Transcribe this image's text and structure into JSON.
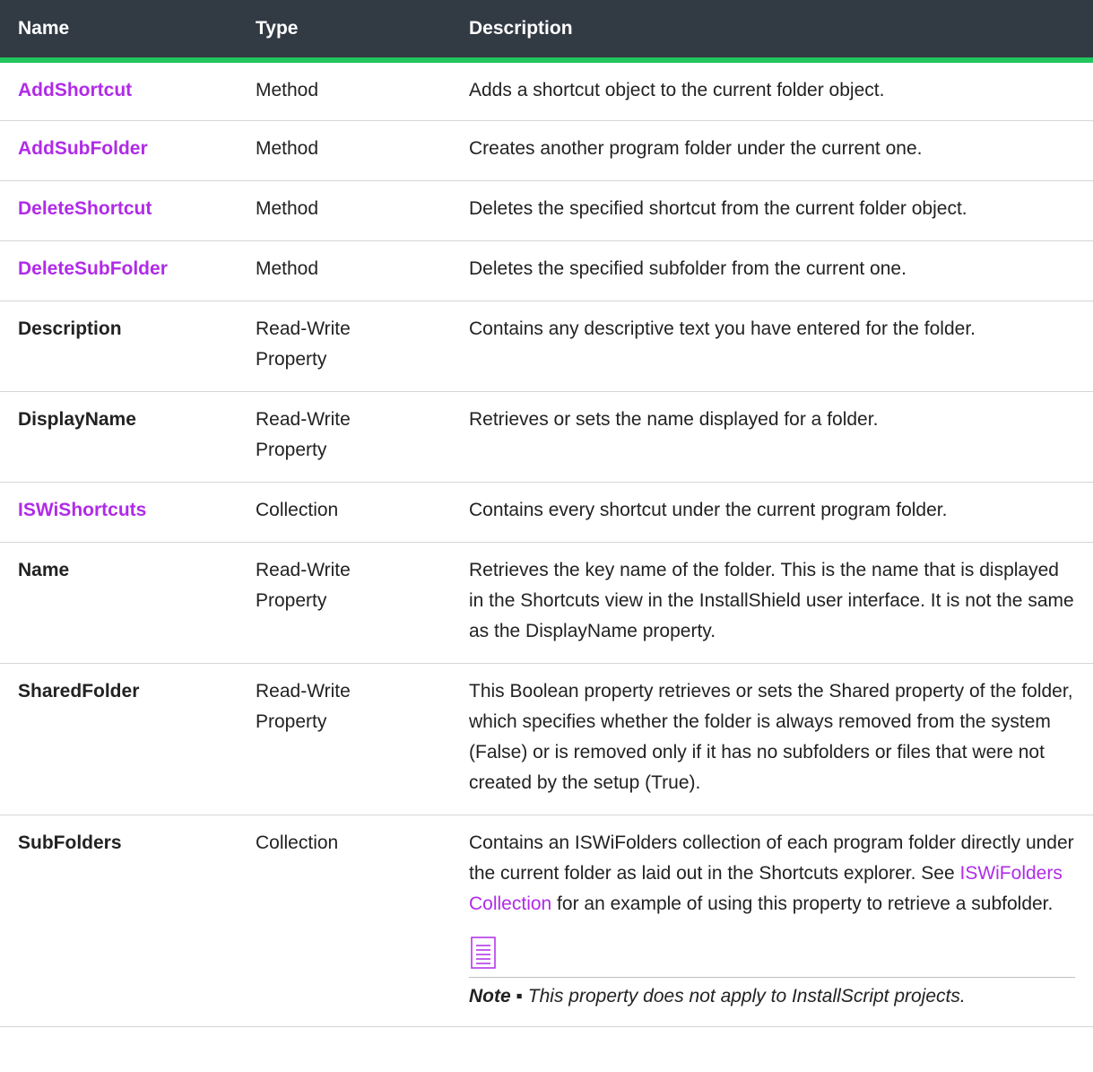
{
  "header": {
    "name": "Name",
    "type": "Type",
    "description": "Description"
  },
  "rows": [
    {
      "name": "AddShortcut",
      "type": "Method",
      "description": "Adds a shortcut object to the current folder object."
    },
    {
      "name": "AddSubFolder",
      "type": "Method",
      "description": "Creates another program folder under the current one."
    },
    {
      "name": "DeleteShortcut",
      "type": "Method",
      "description": "Deletes the specified shortcut from the current folder object."
    },
    {
      "name": "DeleteSubFolder",
      "type": "Method",
      "description": "Deletes the specified subfolder from the current one."
    },
    {
      "name": "Description",
      "type": "Read-Write Property",
      "description": "Contains any descriptive text you have entered for the folder."
    },
    {
      "name": "DisplayName",
      "type": "Read-Write Property",
      "description": "Retrieves or sets the name displayed for a folder."
    },
    {
      "name": "ISWiShortcuts",
      "type": "Collection",
      "description": "Contains every shortcut under the current program folder."
    },
    {
      "name": "Name",
      "type": "Read-Write Property",
      "description": "Retrieves the key name of the folder. This is the name that is displayed in the Shortcuts view in the InstallShield user interface. It is not the same as the DisplayName property."
    },
    {
      "name": "SharedFolder",
      "type": "Read-Write Property",
      "description": "This Boolean property retrieves or sets the Shared property of the folder, which specifies whether the folder is always removed from the system (False) or is removed only if it has no subfolders or files that were not created by the setup (True)."
    },
    {
      "name": "SubFolders",
      "type": "Collection",
      "description_before": "Contains an ISWiFolders collection of each program folder directly under the current folder as laid out in the Shortcuts explorer. See ",
      "description_link": "ISWiFolders Collection",
      "description_after": " for an example of using this property to retrieve a subfolder.",
      "note_label": "Note",
      "note_separator": " ▪ ",
      "note_text": "This property does not apply to InstallScript projects."
    }
  ],
  "colors": {
    "header_bg": "#323a44",
    "header_accent": "#22c55e",
    "link": "#b02be8",
    "text": "#222222"
  },
  "icons": {
    "note": "note-icon"
  }
}
